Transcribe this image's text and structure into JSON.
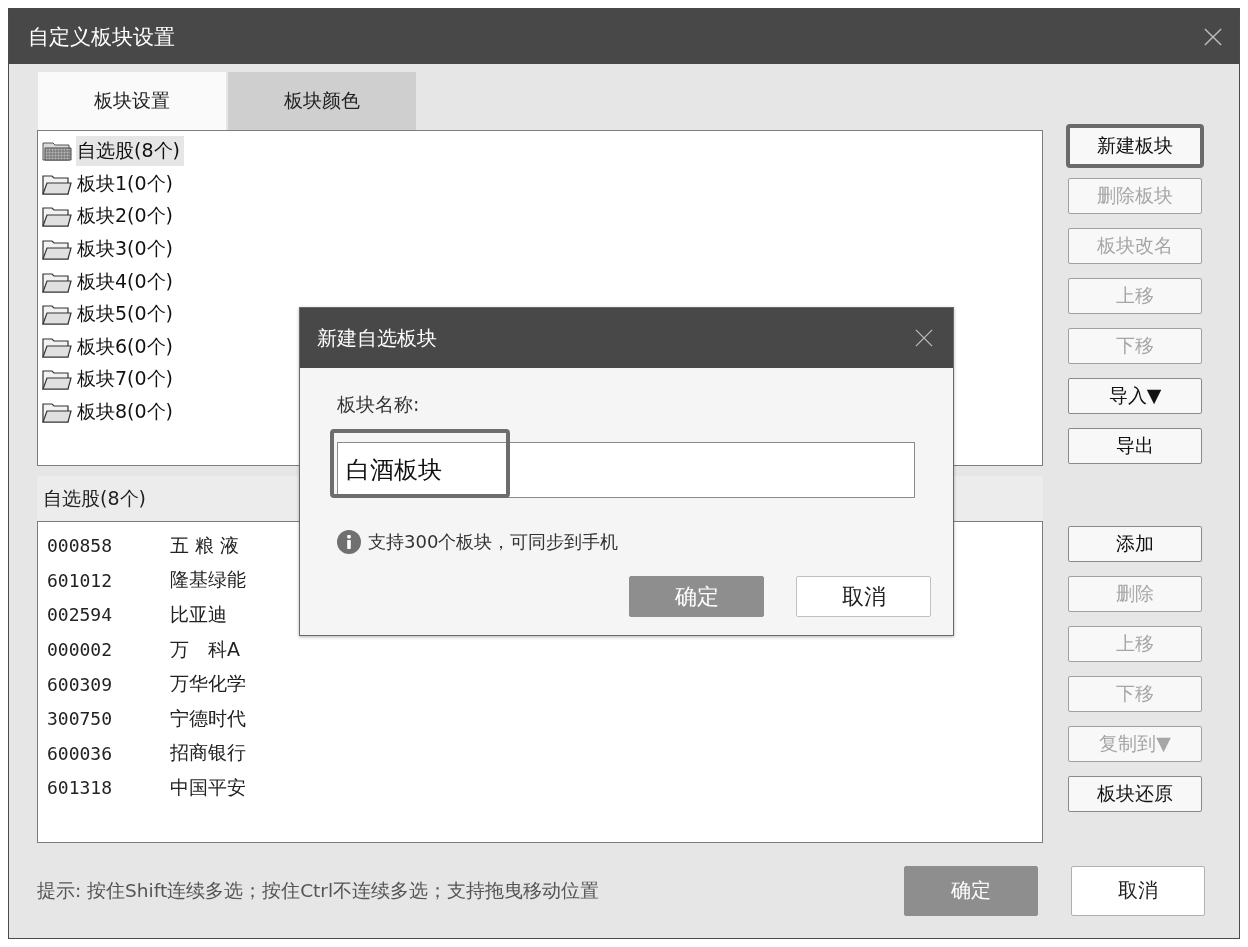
{
  "window": {
    "title": "自定义板块设置"
  },
  "tabs": [
    {
      "label": "板块设置",
      "selected": true
    },
    {
      "label": "板块颜色",
      "selected": false
    }
  ],
  "block_tree": {
    "items": [
      {
        "label": "自选股(8个)",
        "kind": "watchlist",
        "selected": true
      },
      {
        "label": "板块1(0个)",
        "kind": "folder",
        "selected": false
      },
      {
        "label": "板块2(0个)",
        "kind": "folder",
        "selected": false
      },
      {
        "label": "板块3(0个)",
        "kind": "folder",
        "selected": false
      },
      {
        "label": "板块4(0个)",
        "kind": "folder",
        "selected": false
      },
      {
        "label": "板块5(0个)",
        "kind": "folder",
        "selected": false
      },
      {
        "label": "板块6(0个)",
        "kind": "folder",
        "selected": false
      },
      {
        "label": "板块7(0个)",
        "kind": "folder",
        "selected": false
      },
      {
        "label": "板块8(0个)",
        "kind": "folder",
        "selected": false
      }
    ]
  },
  "stock_list": {
    "header": "自选股(8个)",
    "rows": [
      {
        "code": "000858",
        "name": "五 粮 液"
      },
      {
        "code": "601012",
        "name": "隆基绿能"
      },
      {
        "code": "002594",
        "name": "比亚迪"
      },
      {
        "code": "000002",
        "name": "万　科A"
      },
      {
        "code": "600309",
        "name": "万华化学"
      },
      {
        "code": "300750",
        "name": "宁德时代"
      },
      {
        "code": "600036",
        "name": "招商银行"
      },
      {
        "code": "601318",
        "name": "中国平安"
      }
    ]
  },
  "block_buttons": [
    {
      "label": "新建板块",
      "disabled": false,
      "focused": true
    },
    {
      "label": "删除板块",
      "disabled": true,
      "focused": false
    },
    {
      "label": "板块改名",
      "disabled": true,
      "focused": false
    },
    {
      "label": "上移",
      "disabled": true,
      "focused": false
    },
    {
      "label": "下移",
      "disabled": true,
      "focused": false
    },
    {
      "label": "导入▼",
      "disabled": false,
      "focused": false
    },
    {
      "label": "导出",
      "disabled": false,
      "focused": false
    }
  ],
  "stock_buttons": [
    {
      "label": "添加",
      "disabled": false,
      "focused": false
    },
    {
      "label": "删除",
      "disabled": true,
      "focused": false
    },
    {
      "label": "上移",
      "disabled": true,
      "focused": false
    },
    {
      "label": "下移",
      "disabled": true,
      "focused": false
    },
    {
      "label": "复制到▼",
      "disabled": true,
      "focused": false
    },
    {
      "label": "板块还原",
      "disabled": false,
      "focused": false
    }
  ],
  "hint": "提示: 按住Shift连续多选；按住Ctrl不连续多选；支持拖曳移动位置",
  "footer_buttons": [
    {
      "label": "确定",
      "kind": "primary"
    },
    {
      "label": "取消",
      "kind": "secondary"
    }
  ],
  "dialog": {
    "title": "新建自选板块",
    "field_label": "板块名称:",
    "name_field": {
      "value": "白酒板块",
      "highlighted": true
    },
    "info": "支持300个板块，可同步到手机",
    "buttons": [
      {
        "label": "确定",
        "kind": "primary"
      },
      {
        "label": "取消",
        "kind": "secondary"
      }
    ]
  }
}
